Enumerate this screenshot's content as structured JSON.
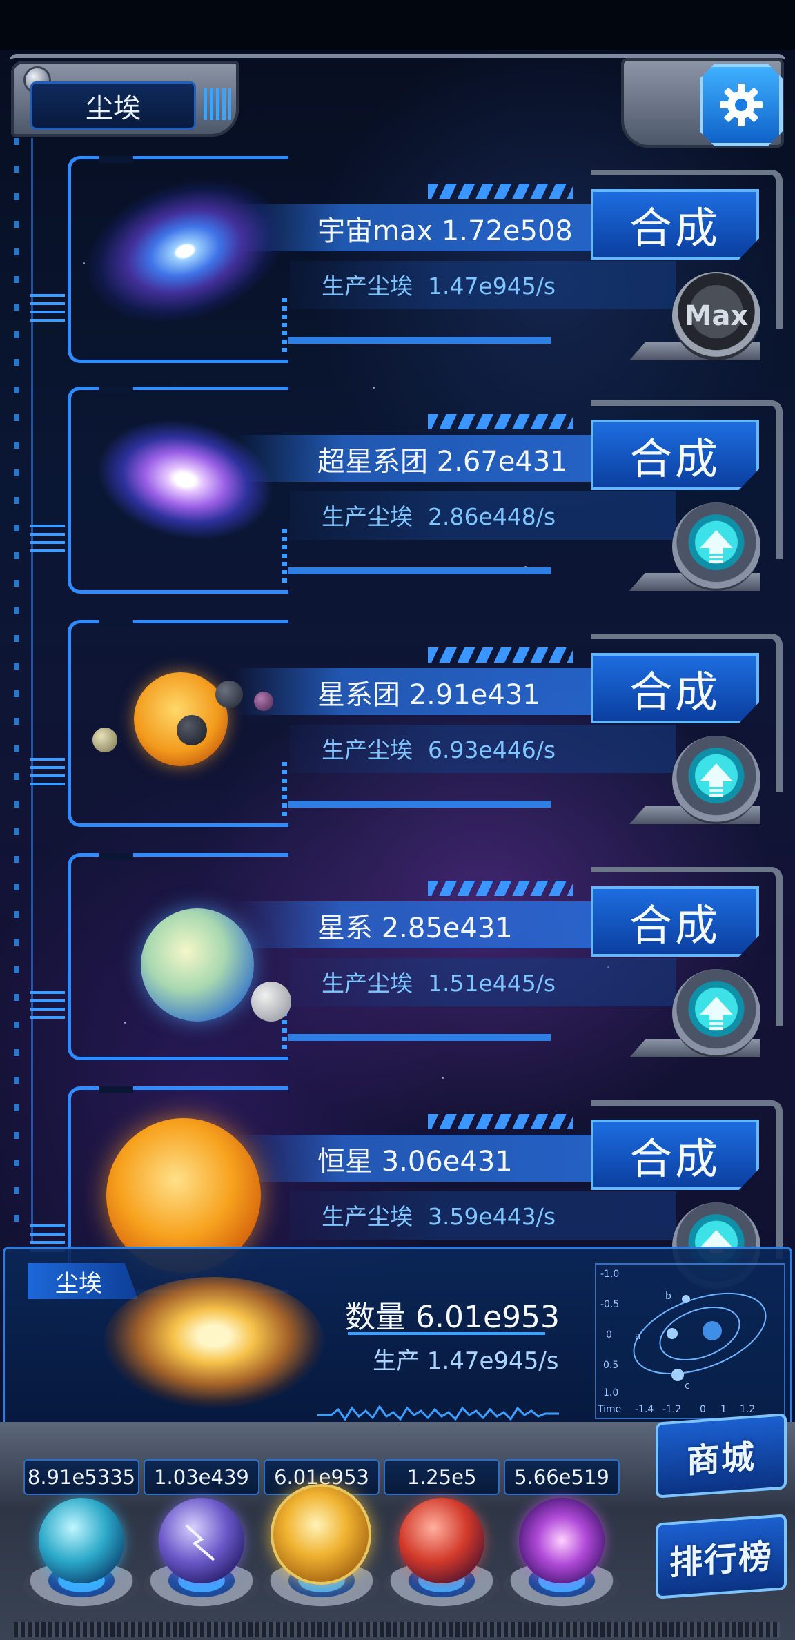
{
  "header": {
    "title": "尘埃"
  },
  "cards": [
    {
      "name": "宇宙max 1.72e508",
      "prod_label": "生产尘埃",
      "prod_value": "1.47e945/s",
      "button": "合成",
      "status_icon": "max-badge-icon",
      "status_text": "Max"
    },
    {
      "name": "超星系团 2.67e431",
      "prod_label": "生产尘埃",
      "prod_value": "2.86e448/s",
      "button": "合成",
      "status_icon": "upgrade-arrow-icon"
    },
    {
      "name": "星系团 2.91e431",
      "prod_label": "生产尘埃",
      "prod_value": "6.93e446/s",
      "button": "合成",
      "status_icon": "upgrade-arrow-icon"
    },
    {
      "name": "星系 2.85e431",
      "prod_label": "生产尘埃",
      "prod_value": "1.51e445/s",
      "button": "合成",
      "status_icon": "upgrade-arrow-icon"
    },
    {
      "name": "恒星 3.06e431",
      "prod_label": "生产尘埃",
      "prod_value": "3.59e443/s",
      "button": "合成",
      "status_icon": "upgrade-arrow-icon"
    }
  ],
  "summary": {
    "tag": "尘埃",
    "count": "数量 6.01e953",
    "production": "生产 1.47e945/s",
    "graph_ticks": [
      "-1.0",
      "-0.5",
      "0",
      "0.5",
      "1.0",
      "Time",
      "-1.4",
      "-1.2",
      "0",
      "1",
      "1.2"
    ],
    "graph_letters": [
      "a",
      "b",
      "c"
    ]
  },
  "tabs": [
    {
      "value": "8.91e5335",
      "icon": "molecule-orb-icon"
    },
    {
      "value": "1.03e439",
      "icon": "lightning-orb-icon"
    },
    {
      "value": "6.01e953",
      "icon": "dust-orb-icon"
    },
    {
      "value": "1.25e5",
      "icon": "brain-orb-icon"
    },
    {
      "value": "5.66e519",
      "icon": "vortex-orb-icon"
    }
  ],
  "side_buttons": {
    "shop": "商城",
    "rank": "排行榜"
  },
  "colors": {
    "accent": "#2f8cff",
    "button": "#1d6de0",
    "prod_text": "#7fc6ff",
    "upgrade": "#3de2e8"
  }
}
